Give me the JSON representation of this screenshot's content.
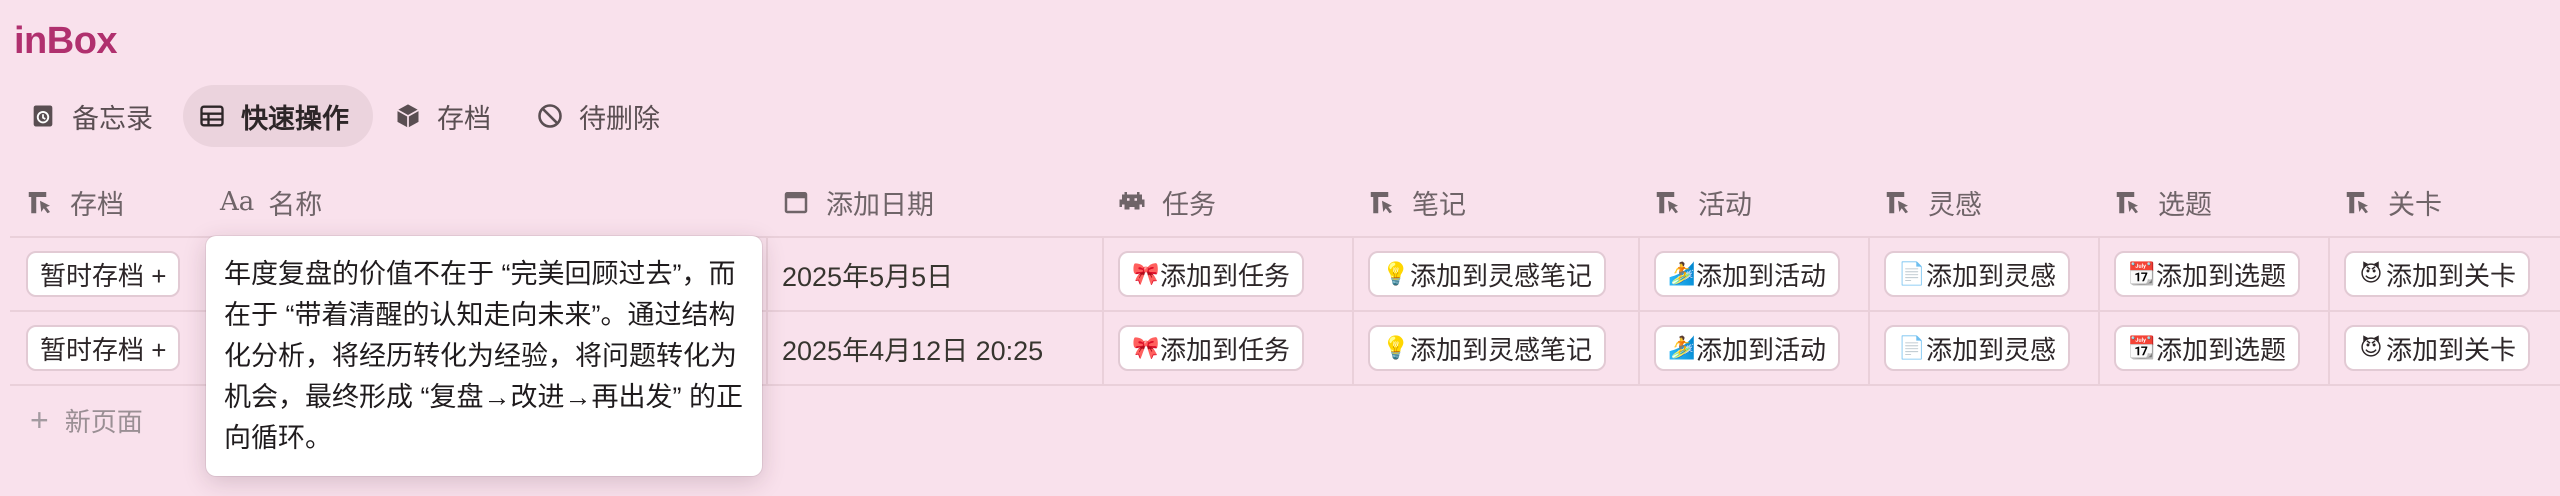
{
  "app": {
    "title": "inBox"
  },
  "views": [
    {
      "label": "备忘录",
      "icon": "memo-icon",
      "active": false
    },
    {
      "label": "快速操作",
      "icon": "table-icon",
      "active": true
    },
    {
      "label": "存档",
      "icon": "box-icon",
      "active": false
    },
    {
      "label": "待删除",
      "icon": "prohibited-icon",
      "active": false
    }
  ],
  "columns": [
    {
      "label": "存档",
      "icon": "pointer-icon"
    },
    {
      "label": "名称",
      "icon": "text-aa-icon",
      "icon_text": "Aa"
    },
    {
      "label": "添加日期",
      "icon": "calendar-icon"
    },
    {
      "label": "任务",
      "icon": "space-invader-icon"
    },
    {
      "label": "笔记",
      "icon": "pointer-icon"
    },
    {
      "label": "活动",
      "icon": "pointer-icon"
    },
    {
      "label": "灵感",
      "icon": "pointer-icon"
    },
    {
      "label": "选题",
      "icon": "pointer-icon"
    },
    {
      "label": "关卡",
      "icon": "pointer-icon"
    }
  ],
  "rows": [
    {
      "archive_btn": "暂时存档 +",
      "date": "2025年5月5日",
      "task": {
        "emoji": "🎀",
        "label": "添加到任务"
      },
      "note": {
        "emoji": "💡",
        "label": "添加到灵感笔记"
      },
      "activity": {
        "emoji": "🏄",
        "label": "添加到活动"
      },
      "idea": {
        "emoji": "📄",
        "label": "添加到灵感"
      },
      "topic": {
        "emoji": "📆",
        "label": "添加到选题"
      },
      "level": {
        "emoji": "😈",
        "label": "添加到关卡"
      }
    },
    {
      "archive_btn": "暂时存档 +",
      "date": "2025年4月12日 20:25",
      "task": {
        "emoji": "🎀",
        "label": "添加到任务"
      },
      "note": {
        "emoji": "💡",
        "label": "添加到灵感笔记"
      },
      "activity": {
        "emoji": "🏄",
        "label": "添加到活动"
      },
      "idea": {
        "emoji": "📄",
        "label": "添加到灵感"
      },
      "topic": {
        "emoji": "📆",
        "label": "添加到选题"
      },
      "level": {
        "emoji": "😈",
        "label": "添加到关卡"
      }
    }
  ],
  "new_page": {
    "label": "新页面",
    "icon": "plus-icon"
  },
  "popover": {
    "text": "年度复盘的价值不在于 “完美回顾过去”，而在于 “带着清醒的认知走向未来”。通过结构化分析，将经历转化为经验，将问题转化为机会，最终形成 “复盘→改进→再出发” 的正向循环。"
  },
  "colors": {
    "background": "#f9e1ec",
    "title": "#b0306e",
    "active_view": "#ebd3dd"
  }
}
